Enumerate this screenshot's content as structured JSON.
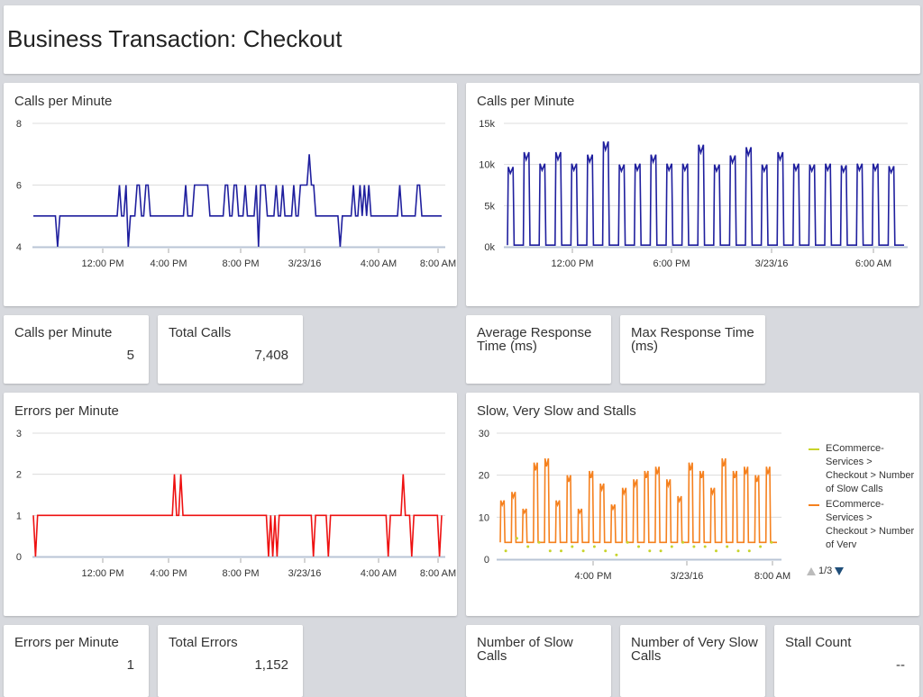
{
  "page": {
    "title": "Business Transaction: Checkout"
  },
  "colors": {
    "navy": "#1f1f9e",
    "red": "#ee1111",
    "orange": "#f5811f",
    "yellowgreen": "#c8d42a",
    "grid": "#dddddd"
  },
  "cards": {
    "calls_chart_1": {
      "title": "Calls per Minute"
    },
    "calls_chart_2": {
      "title": "Calls per Minute"
    },
    "errors_chart": {
      "title": "Errors per Minute"
    },
    "slow_chart": {
      "title": "Slow, Very Slow and Stalls"
    },
    "stat_calls_per_min": {
      "label": "Calls per Minute",
      "value": "5"
    },
    "stat_total_calls": {
      "label": "Total Calls",
      "value": "7,408"
    },
    "stat_avg_response": {
      "label": "Average Response Time (ms)",
      "value": ""
    },
    "stat_max_response": {
      "label": "Max Response Time (ms)",
      "value": ""
    },
    "stat_errors_per_min": {
      "label": "Errors per Minute",
      "value": "1"
    },
    "stat_total_errors": {
      "label": "Total Errors",
      "value": "1,152"
    },
    "stat_slow_calls": {
      "label": "Number of Slow Calls",
      "value": ""
    },
    "stat_very_slow_calls": {
      "label": "Number of Very Slow Calls",
      "value": ""
    },
    "stat_stall_count": {
      "label": "Stall Count",
      "value": "--"
    }
  },
  "legend": {
    "items": [
      {
        "label": "ECommerce-Services > Checkout > Number of Slow Calls",
        "color": "#c8d42a"
      },
      {
        "label": "ECommerce-Services > Checkout > Number of Verv",
        "color": "#f5811f"
      }
    ],
    "pager": "1/3"
  },
  "chart_data": [
    {
      "type": "line",
      "title": "Calls per Minute",
      "yticks": [
        "4",
        "6",
        "8"
      ],
      "ylim": [
        4,
        8
      ],
      "xticks": [
        "12:00 PM",
        "4:00 PM",
        "8:00 PM",
        "3/23/16",
        "4:00 AM",
        "8:00 AM"
      ],
      "grid": true,
      "series": [
        {
          "color": "#1f1f9e",
          "values": [
            5,
            5,
            5,
            5,
            5,
            5,
            5,
            5,
            5,
            5,
            5,
            4,
            5,
            5,
            5,
            5,
            5,
            5,
            5,
            5,
            5,
            5,
            5,
            5,
            5,
            5,
            5,
            5,
            5,
            5,
            5,
            5,
            5,
            5,
            5,
            5,
            5,
            5,
            5,
            6,
            5,
            5,
            6,
            4,
            5,
            5,
            5,
            6,
            6,
            5,
            5,
            6,
            6,
            5,
            5,
            5,
            5,
            5,
            5,
            5,
            5,
            5,
            5,
            5,
            5,
            5,
            5,
            5,
            5,
            6,
            5,
            5,
            5,
            6,
            6,
            6,
            6,
            6,
            6,
            6,
            5,
            5,
            5,
            5,
            5,
            5,
            5,
            6,
            6,
            5,
            5,
            6,
            6,
            5,
            5,
            5,
            6,
            5,
            5,
            5,
            5,
            6,
            4,
            6,
            6,
            6,
            5,
            5,
            5,
            5,
            6,
            5,
            5,
            6,
            5,
            5,
            5,
            5,
            6,
            5,
            5,
            6,
            6,
            6,
            6,
            7,
            6,
            6,
            5,
            5,
            5,
            5,
            5,
            5,
            5,
            5,
            5,
            5,
            5,
            4,
            5,
            5,
            5,
            5,
            5,
            6,
            5,
            5,
            6,
            5,
            6,
            5,
            6,
            5,
            5,
            5,
            5,
            5,
            5,
            5,
            5,
            5,
            5,
            5,
            5,
            5,
            6,
            5,
            5,
            5,
            5,
            5,
            5,
            5,
            6,
            6,
            5,
            5,
            5,
            5,
            5,
            5,
            5,
            5,
            5,
            5
          ]
        }
      ]
    },
    {
      "type": "line",
      "title": "Calls per Minute",
      "yticks": [
        "0k",
        "5k",
        "10k",
        "15k"
      ],
      "ylim": [
        0,
        15
      ],
      "xticks": [
        "12:00 PM",
        "6:00 PM",
        "3/23/16",
        "6:00 AM"
      ],
      "grid": true,
      "series": [
        {
          "color": "#1f1f9e",
          "peaks": [
            9.7,
            11.5,
            10.1,
            11.5,
            10.1,
            11.2,
            12.8,
            10.0,
            10.1,
            11.2,
            10.1,
            10.1,
            12.4,
            10.0,
            11.1,
            12.1,
            10.0,
            11.5,
            10.1,
            10.0,
            10.1,
            9.9,
            10.1,
            10.1,
            9.8
          ]
        }
      ]
    },
    {
      "type": "line",
      "title": "Errors per Minute",
      "yticks": [
        "0",
        "1",
        "2",
        "3"
      ],
      "ylim": [
        0,
        3
      ],
      "xticks": [
        "12:00 PM",
        "4:00 PM",
        "8:00 PM",
        "3/23/16",
        "4:00 AM",
        "8:00 AM"
      ],
      "grid": true,
      "series": [
        {
          "color": "#ee1111",
          "values": [
            1,
            0,
            1,
            1,
            1,
            1,
            1,
            1,
            1,
            1,
            1,
            1,
            1,
            1,
            1,
            1,
            1,
            1,
            1,
            1,
            1,
            1,
            1,
            1,
            1,
            1,
            1,
            1,
            1,
            1,
            1,
            1,
            1,
            1,
            1,
            1,
            1,
            1,
            1,
            1,
            1,
            1,
            1,
            1,
            1,
            1,
            1,
            1,
            1,
            1,
            1,
            1,
            1,
            1,
            1,
            1,
            1,
            1,
            1,
            1,
            1,
            1,
            1,
            1,
            1,
            1,
            2,
            1,
            1,
            2,
            1,
            1,
            1,
            1,
            1,
            1,
            1,
            1,
            1,
            1,
            1,
            1,
            1,
            1,
            1,
            1,
            1,
            1,
            1,
            1,
            1,
            1,
            1,
            1,
            1,
            1,
            1,
            1,
            1,
            1,
            1,
            1,
            1,
            1,
            1,
            1,
            1,
            1,
            1,
            1,
            0,
            1,
            0,
            1,
            0,
            1,
            1,
            1,
            1,
            1,
            1,
            1,
            1,
            1,
            1,
            1,
            1,
            1,
            1,
            1,
            1,
            0,
            1,
            1,
            1,
            1,
            1,
            1,
            0,
            1,
            1,
            1,
            1,
            1,
            1,
            1,
            1,
            1,
            1,
            1,
            1,
            1,
            1,
            1,
            1,
            1,
            1,
            1,
            1,
            1,
            1,
            1,
            1,
            1,
            1,
            1,
            0,
            1,
            1,
            1,
            1,
            1,
            1,
            2,
            1,
            1,
            1,
            0,
            1,
            1,
            1,
            1,
            1,
            1,
            1,
            1,
            1,
            1,
            1,
            1,
            0,
            1
          ]
        }
      ]
    },
    {
      "type": "line",
      "title": "Slow, Very Slow and Stalls",
      "yticks": [
        "0",
        "10",
        "20",
        "30"
      ],
      "ylim": [
        0,
        30
      ],
      "xticks": [
        "4:00 PM",
        "3/23/16",
        "8:00 AM"
      ],
      "grid": true,
      "series": [
        {
          "name": "ECommerce-Services > Checkout > Number of Slow Calls",
          "color": "#c8d42a",
          "values": [
            2,
            5,
            3,
            4,
            2,
            2,
            3,
            2,
            3,
            2,
            1,
            4,
            3,
            2,
            2,
            3,
            4,
            3,
            3,
            2,
            3,
            2,
            2,
            3,
            4
          ]
        },
        {
          "name": "ECommerce-Services > Checkout > Number of Verv",
          "color": "#f5811f",
          "peaks": [
            14,
            16,
            12,
            23,
            24,
            14,
            20,
            12,
            21,
            18,
            13,
            17,
            19,
            21,
            22,
            19,
            15,
            23,
            21,
            17,
            24,
            21,
            22,
            20,
            22
          ]
        }
      ]
    }
  ]
}
